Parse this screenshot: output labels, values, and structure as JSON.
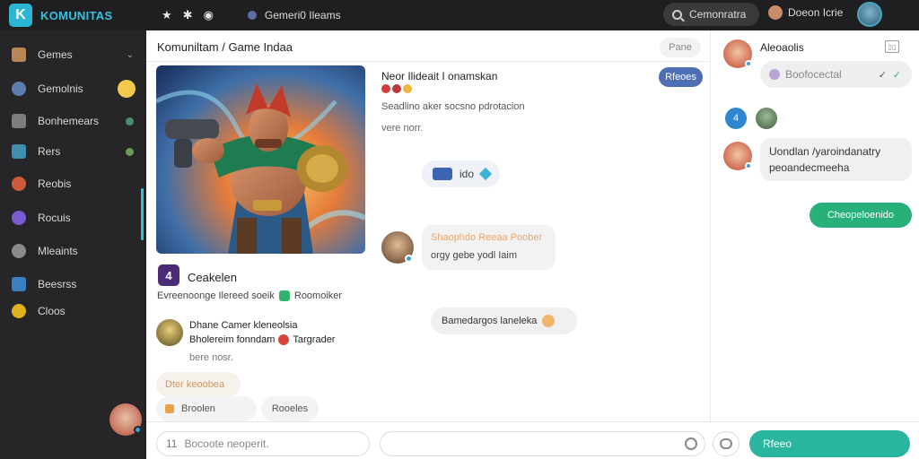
{
  "topbar": {
    "brand": "KOMUNITAS",
    "brand_logo": "K",
    "icons": [
      "star-icon",
      "settings-icon",
      "clock-icon"
    ],
    "game_label": "Gemeri0 Ileams",
    "search_label": "Cemonratra",
    "user_label": "Doeon Icrie"
  },
  "sidebar": {
    "items": [
      {
        "label": "Gemes",
        "icon": "game-icon"
      },
      {
        "label": "Gemolnis",
        "icon": "community-icon"
      },
      {
        "label": "Bonhemears",
        "icon": "members-icon"
      },
      {
        "label": "Rers",
        "icon": "rank-icon"
      },
      {
        "label": "Reobis",
        "icon": "rewards-icon"
      },
      {
        "label": "Rocuis",
        "icon": "groups-icon"
      },
      {
        "label": "Mleaints",
        "icon": "events-icon"
      },
      {
        "label": "Beesrss",
        "icon": "resources-icon"
      },
      {
        "label": "Cloos",
        "icon": "settings-icon"
      }
    ]
  },
  "main": {
    "title": "Komuniltam / Game Indaa",
    "header_pill": "Pane",
    "post": {
      "author_line": "Neor Ilideait I onamskan",
      "subtitle": "Seadlino aker socsno pdrotacion",
      "meta": "vere norr.",
      "follow_label": "Rfeoes"
    },
    "chip_label": "ido",
    "bubble1_title": "Shaophdo Reeaa Poober",
    "bubble1_text": "orgy gebe yodl Iaim",
    "bubble2_text": "Bamedargos laneleka",
    "app": {
      "icon": "4",
      "name": "Ceakelen",
      "desc": "Evreenoonge Ilereed soeik",
      "tag": "Roomoiker"
    },
    "row2": {
      "line1": "Dhane Camer kleneolsia",
      "line2a": "Bholereim fonndam",
      "line2b": "Targrader",
      "line3": "bere nosr."
    },
    "pill_orange": "Dter keoobea",
    "pill_b": "Broolen",
    "pill_c": "Rooeles"
  },
  "right": {
    "name": "Aleoaolis",
    "pin_icon": "pin-icon",
    "input_text": "Boofocectal",
    "icon1_text": "4",
    "bubble_text": "Uondlan /yaroindanatry peoandecmeeha",
    "green_label": "Cheopeloenido"
  },
  "footer": {
    "input1_placeholder": "Bocoote neoperit.",
    "input1_icon": "11",
    "send_label": "Rfeeo"
  }
}
